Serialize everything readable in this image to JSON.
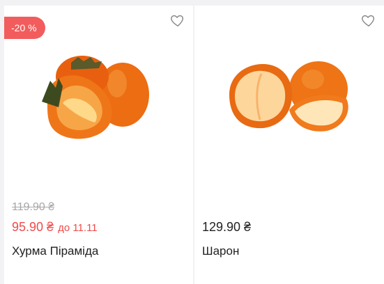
{
  "products": [
    {
      "badge": "-20 %",
      "old_price": "119.90 ₴",
      "price": "95.90 ₴",
      "promo_until": "до 11.11",
      "name": "Хурма Піраміда",
      "image_icon": "persimmon-pyramid-image",
      "favorite_icon": "heart-outline-icon"
    },
    {
      "price": "129.90 ₴",
      "name": "Шарон",
      "image_icon": "sharon-fruit-image",
      "favorite_icon": "heart-outline-icon"
    }
  ],
  "colors": {
    "sale": "#f25c5c",
    "text": "#222222",
    "muted": "#a7a7a7",
    "fruit": "#f07a1a",
    "fruit_light": "#ffd27a"
  }
}
